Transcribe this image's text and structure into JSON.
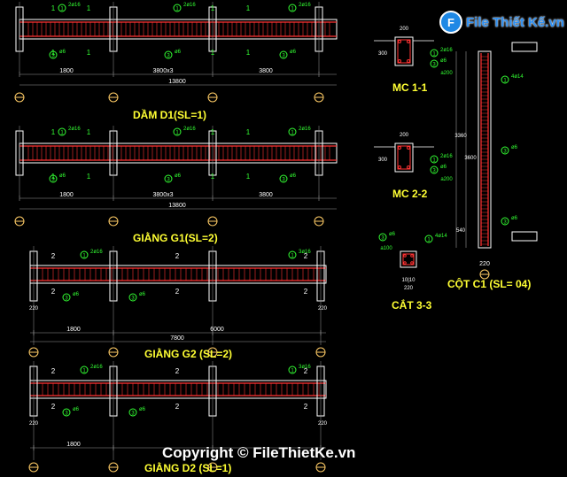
{
  "titles": {
    "d1": "DẦM D1(SL=1)",
    "g1": "GIẰNG G1(SL=2)",
    "g2": "GIẰNG G2 (SL=2)",
    "d2": "GIẰNG D2 (SL=1)",
    "mc11": "MC 1-1",
    "mc22": "MC 2-2",
    "cat33": "CẮT 3-3",
    "cot": "CỘT C1 (SL= 04)"
  },
  "dims": {
    "d1_total": "13800",
    "d1_spans": [
      "1800",
      "3800x3",
      "3800"
    ],
    "g1_total": "13800",
    "g1_spans": [
      "1800",
      "3800x3",
      "3800"
    ],
    "g2_total": "7800",
    "g2_spans": [
      "1800",
      "6000"
    ],
    "d2_spans": [
      "1800"
    ],
    "end_220": "220",
    "mc_200": "200",
    "mc_300": "300",
    "mc_d220": "220",
    "mc_d200": "200",
    "col_3360": "3360",
    "col_3600": "3600",
    "col_540": "540",
    "col_220": "220",
    "cat_220": "220",
    "cat_1010": "10|10"
  },
  "rebar": {
    "top_bar": "2ø16",
    "bot_bar": "2ø16",
    "bar_3": "3ø16",
    "stirrup": "ø6",
    "spacing": "a150",
    "spacing_200": "a200",
    "col_bar": "4ø14",
    "col_stirrup": "ø6",
    "col_spacing": "a100"
  },
  "section_marks": [
    "1",
    "2",
    "3"
  ],
  "watermark": {
    "copyright": "Copyright © FileThietKe.vn",
    "logo_text": "File Thiết Kế.vn",
    "logo_mark": "F"
  },
  "colors": {
    "background": "#000000",
    "line": "#ffffff",
    "rebar": "#ff3333",
    "dimension": "#33ff33",
    "title": "#ffff33",
    "axis_marker": "#ffcc66",
    "grid": "#999999"
  }
}
